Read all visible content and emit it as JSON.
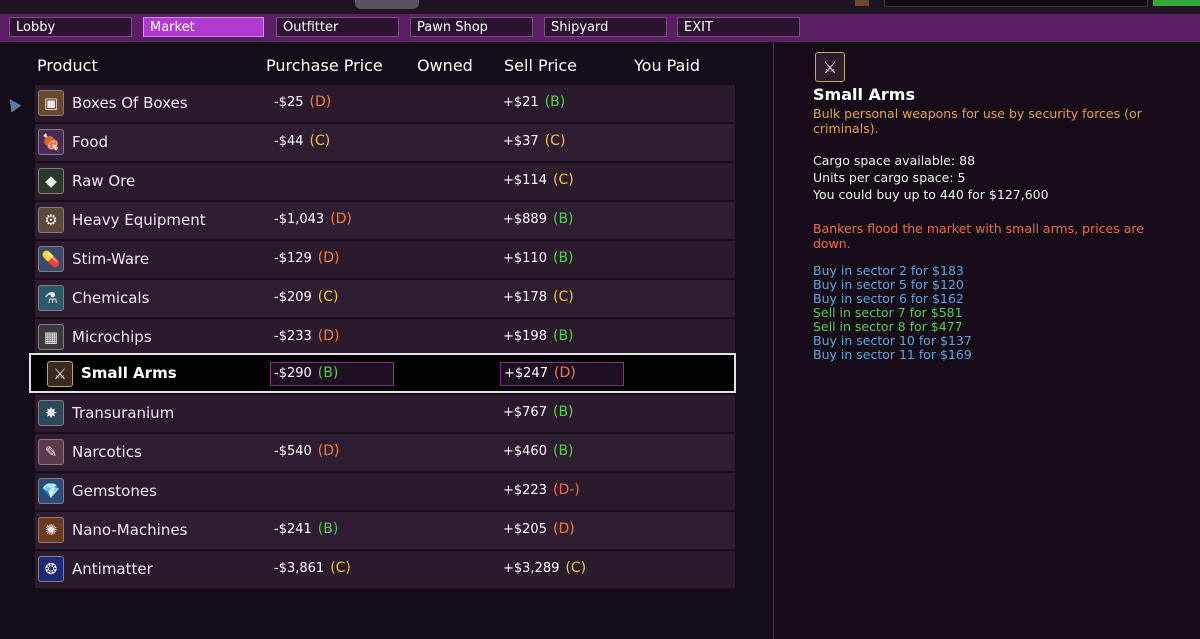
{
  "nav": {
    "tabs": [
      {
        "label": "Lobby",
        "active": false
      },
      {
        "label": "Market",
        "active": true
      },
      {
        "label": "Outfitter",
        "active": false
      },
      {
        "label": "Pawn Shop",
        "active": false
      },
      {
        "label": "Shipyard",
        "active": false
      },
      {
        "label": "EXIT",
        "active": false
      }
    ]
  },
  "table": {
    "headers": {
      "product": "Product",
      "purchase_price": "Purchase Price",
      "owned": "Owned",
      "sell_price": "Sell Price",
      "you_paid": "You Paid"
    },
    "rows": [
      {
        "name": "Boxes Of Boxes",
        "icon": "box-icon",
        "buy": "-$25",
        "buy_grade": "(D)",
        "sell": "+$21",
        "sell_grade": "(B)"
      },
      {
        "name": "Food",
        "icon": "food-icon",
        "buy": "-$44",
        "buy_grade": "(C)",
        "sell": "+$37",
        "sell_grade": "(C)"
      },
      {
        "name": "Raw Ore",
        "icon": "ore-icon",
        "buy": "",
        "buy_grade": "",
        "sell": "+$114",
        "sell_grade": "(C)"
      },
      {
        "name": "Heavy Equipment",
        "icon": "gear-icon",
        "buy": "-$1,043",
        "buy_grade": "(D)",
        "sell": "+$889",
        "sell_grade": "(B)"
      },
      {
        "name": "Stim-Ware",
        "icon": "pill-icon",
        "buy": "-$129",
        "buy_grade": "(D)",
        "sell": "+$110",
        "sell_grade": "(B)"
      },
      {
        "name": "Chemicals",
        "icon": "flask-icon",
        "buy": "-$209",
        "buy_grade": "(C)",
        "sell": "+$178",
        "sell_grade": "(C)"
      },
      {
        "name": "Microchips",
        "icon": "chip-icon",
        "buy": "-$233",
        "buy_grade": "(D)",
        "sell": "+$198",
        "sell_grade": "(B)"
      },
      {
        "name": "Small Arms",
        "icon": "crossed-swords-icon",
        "buy": "-$290",
        "buy_grade": "(B)",
        "sell": "+$247",
        "sell_grade": "(D)",
        "selected": true
      },
      {
        "name": "Transuranium",
        "icon": "atom-icon",
        "buy": "",
        "buy_grade": "",
        "sell": "+$767",
        "sell_grade": "(B)"
      },
      {
        "name": "Narcotics",
        "icon": "syringe-icon",
        "buy": "-$540",
        "buy_grade": "(D)",
        "sell": "+$460",
        "sell_grade": "(B)"
      },
      {
        "name": "Gemstones",
        "icon": "gem-icon",
        "buy": "",
        "buy_grade": "",
        "sell": "+$223",
        "sell_grade": "(D-)"
      },
      {
        "name": "Nano-Machines",
        "icon": "nano-icon",
        "buy": "-$241",
        "buy_grade": "(B)",
        "sell": "+$205",
        "sell_grade": "(D)"
      },
      {
        "name": "Antimatter",
        "icon": "antimatter-icon",
        "buy": "-$3,861",
        "buy_grade": "(C)",
        "sell": "+$3,289",
        "sell_grade": "(C)"
      }
    ]
  },
  "detail": {
    "title": "Small Arms",
    "description": "Bulk personal weapons for use by security forces (or criminals).",
    "cargo_available": "Cargo space available: 88",
    "units_per_space": "Units per cargo space: 5",
    "could_buy": "You could buy up to 440 for $127,600",
    "news": "Bankers flood the market with small arms, prices are down.",
    "trades": [
      {
        "text": "Buy in sector 2 for $183",
        "kind": "buy"
      },
      {
        "text": "Buy in sector 5 for $120",
        "kind": "buy"
      },
      {
        "text": "Buy in sector 6 for $162",
        "kind": "buy"
      },
      {
        "text": "Sell in sector 7 for $581",
        "kind": "sell"
      },
      {
        "text": "Sell in sector 8 for $477",
        "kind": "sell"
      },
      {
        "text": "Buy in sector 10 for $137",
        "kind": "buy"
      },
      {
        "text": "Buy in sector 11 for $169",
        "kind": "buy"
      }
    ]
  },
  "colors": {
    "nav_bg": "#5a1f62",
    "tab_active": "#b03ad0",
    "grade_B": "#4ed04e",
    "grade_C": "#f0c830",
    "grade_D": "#ff7a30",
    "trade_buy": "#5aa8e0",
    "trade_sell": "#4ed04e",
    "news": "#f06a50",
    "description": "#e8a048"
  }
}
